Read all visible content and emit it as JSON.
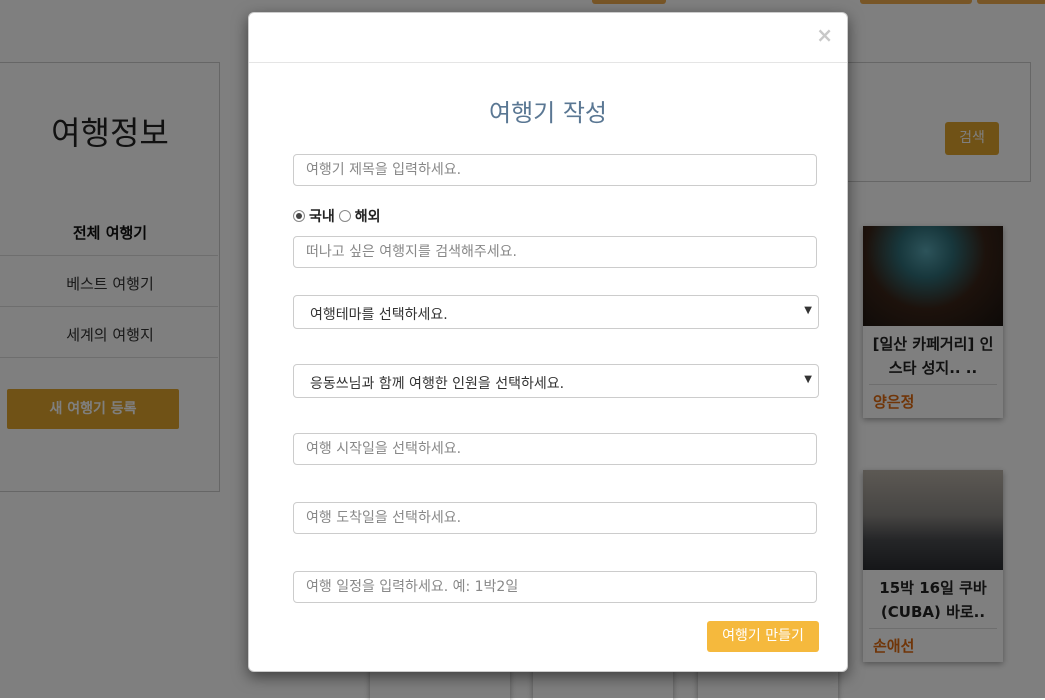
{
  "background": {
    "sidebar": {
      "title": "여행정보",
      "items": [
        {
          "label": "전체 여행기",
          "active": true
        },
        {
          "label": "베스트 여행기",
          "active": false
        },
        {
          "label": "세계의 여행지",
          "active": false
        }
      ],
      "new_button": "새 여행기 등록"
    },
    "search_button": "검색",
    "cards": [
      {
        "title": "[일산 카페거리] 인스타 성지.. ..",
        "author": "양은정"
      },
      {
        "title": "15박 16일 쿠바 (CUBA) 바로..",
        "author": "손애선"
      }
    ]
  },
  "modal": {
    "close_label": "×",
    "title": "여행기 작성",
    "title_placeholder": "여행기 제목을 입력하세요.",
    "region_options": [
      {
        "label": "국내",
        "checked": true
      },
      {
        "label": "해외",
        "checked": false
      }
    ],
    "destination_placeholder": "떠나고 싶은 여행지를 검색해주세요.",
    "theme_select": "여행테마를 선택하세요.",
    "companion_select": "응동쓰님과 함께 여행한 인원을 선택하세요.",
    "start_date_placeholder": "여행 시작일을 선택하세요.",
    "end_date_placeholder": "여행 도착일을 선택하세요.",
    "schedule_placeholder": "여행 일정을 입력하세요. 예: 1박2일",
    "submit_label": "여행기 만들기"
  },
  "colors": {
    "accent": "#f0ad4e",
    "title_blue": "#5a7793",
    "author_orange": "#e06b10"
  }
}
